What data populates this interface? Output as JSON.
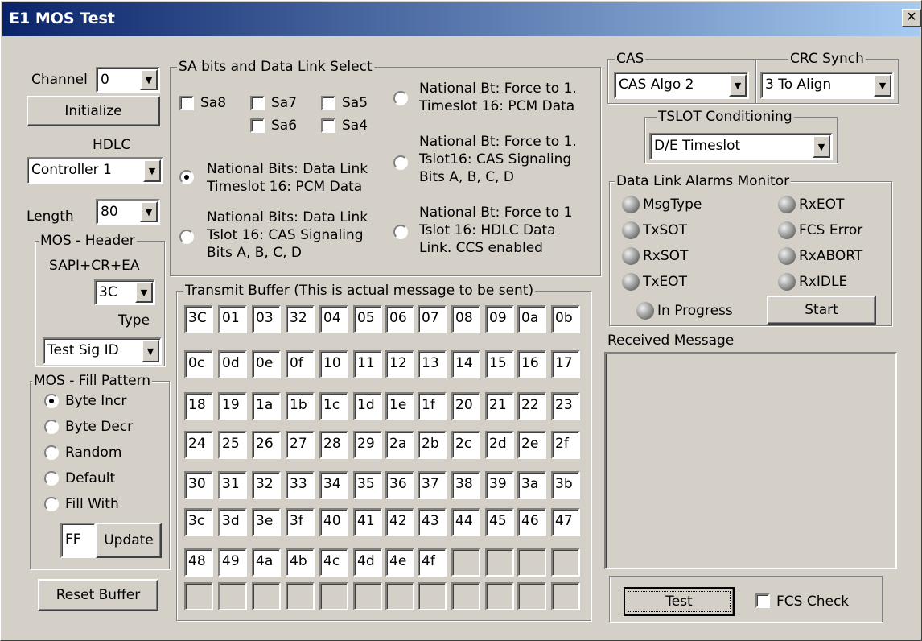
{
  "window": {
    "title": "E1 MOS Test",
    "close_glyph": "✕"
  },
  "channel": {
    "label": "Channel",
    "value": "0"
  },
  "initialize_label": "Initialize",
  "hdlc": {
    "label": "HDLC",
    "value": "Controller 1"
  },
  "length": {
    "label": "Length",
    "value": "80"
  },
  "mos_header": {
    "title": "MOS - Header",
    "sapi_label": "SAPI+CR+EA",
    "sapi_value": "3C",
    "type_label": "Type",
    "type_value": "Test Sig ID"
  },
  "fill_pattern": {
    "title": "MOS - Fill Pattern",
    "options": [
      "Byte Incr",
      "Byte Decr",
      "Random",
      "Default",
      "Fill With"
    ],
    "selected_index": 0,
    "fill_value": "FF",
    "update_label": "Update"
  },
  "reset_buffer_label": "Reset Buffer",
  "sa_bits": {
    "title": "SA bits and Data Link Select",
    "checkboxes": [
      "Sa8",
      "Sa7",
      "Sa5",
      "Sa6",
      "Sa4"
    ],
    "radios": [
      {
        "lines": [
          "National Bits: Data Link",
          "Timeslot 16: PCM Data"
        ],
        "selected": true
      },
      {
        "lines": [
          "National Bits: Data Link",
          "Tslot 16: CAS Signaling",
          "Bits A, B, C, D"
        ],
        "selected": false
      },
      {
        "lines": [
          "National Bt: Force to 1.",
          "Timeslot 16: PCM Data"
        ],
        "selected": false
      },
      {
        "lines": [
          "National Bt: Force to 1.",
          "Tslot16: CAS Signaling",
          "Bits A, B, C, D"
        ],
        "selected": false
      },
      {
        "lines": [
          "National Bt: Force to 1",
          "Tslot 16: HDLC Data",
          "Link. CCS enabled"
        ],
        "selected": false
      }
    ]
  },
  "transmit_buffer": {
    "title": "Transmit Buffer (This is actual message to be sent)",
    "bytes": [
      "3C",
      "01",
      "03",
      "32",
      "04",
      "05",
      "06",
      "07",
      "08",
      "09",
      "0a",
      "0b",
      "0c",
      "0d",
      "0e",
      "0f",
      "10",
      "11",
      "12",
      "13",
      "14",
      "15",
      "16",
      "17",
      "18",
      "19",
      "1a",
      "1b",
      "1c",
      "1d",
      "1e",
      "1f",
      "20",
      "21",
      "22",
      "23",
      "24",
      "25",
      "26",
      "27",
      "28",
      "29",
      "2a",
      "2b",
      "2c",
      "2d",
      "2e",
      "2f",
      "30",
      "31",
      "32",
      "33",
      "34",
      "35",
      "36",
      "37",
      "38",
      "39",
      "3a",
      "3b",
      "3c",
      "3d",
      "3e",
      "3f",
      "40",
      "41",
      "42",
      "43",
      "44",
      "45",
      "46",
      "47",
      "48",
      "49",
      "4a",
      "4b",
      "4c",
      "4d",
      "4e",
      "4f"
    ],
    "total_cells": 96
  },
  "cas": {
    "title": "CAS",
    "value": "CAS Algo 2"
  },
  "crc": {
    "title": "CRC Synch",
    "value": "3 To Align"
  },
  "tslot": {
    "title": "TSLOT Conditioning",
    "value": "D/E Timeslot"
  },
  "alarms": {
    "title": "Data Link Alarms Monitor",
    "left": [
      "MsgType",
      "TxSOT",
      "RxSOT",
      "TxEOT"
    ],
    "right": [
      "RxEOT",
      "FCS Error",
      "RxABORT",
      "RxIDLE"
    ],
    "in_progress": "In Progress",
    "start_label": "Start"
  },
  "received": {
    "label": "Received Message",
    "text": ""
  },
  "test_label": "Test",
  "fcs_check_label": "FCS Check",
  "colors": {
    "face": "#d4d0c8",
    "title_start": "#0a246a",
    "title_end": "#a6caf0"
  }
}
